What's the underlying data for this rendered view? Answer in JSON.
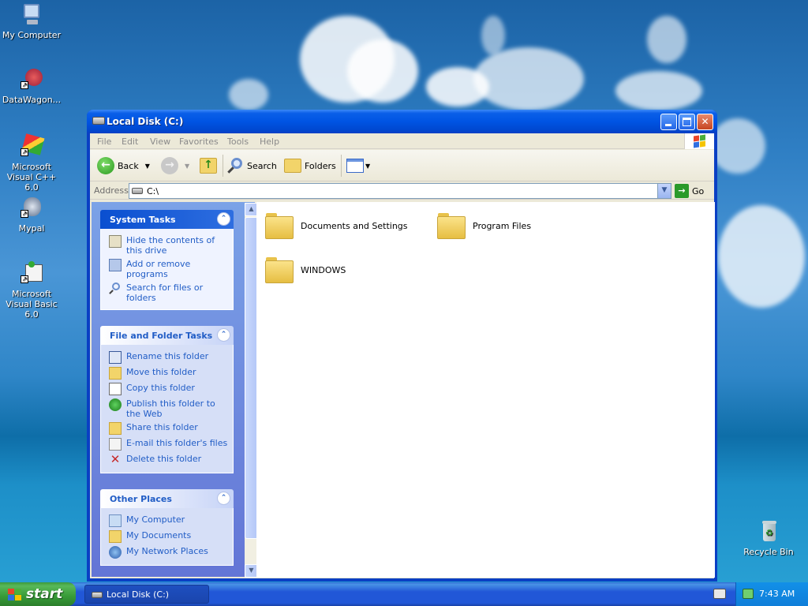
{
  "desktop": {
    "icons": [
      {
        "label": "My Computer"
      },
      {
        "label": "DataWagon..."
      },
      {
        "label": "Microsoft Visual C++ 6.0"
      },
      {
        "label": "Mypal"
      },
      {
        "label": "Microsoft Visual Basic 6.0"
      },
      {
        "label": "Recycle Bin"
      }
    ]
  },
  "window": {
    "title": "Local Disk (C:)",
    "menu": [
      "File",
      "Edit",
      "View",
      "Favorites",
      "Tools",
      "Help"
    ],
    "toolbar": {
      "back": "Back",
      "search": "Search",
      "folders": "Folders"
    },
    "address": {
      "label": "Address",
      "value": "C:\\",
      "go": "Go"
    },
    "taskpane": {
      "system_tasks": {
        "title": "System Tasks",
        "items": [
          "Hide the contents of this drive",
          "Add or remove programs",
          "Search for files or folders"
        ]
      },
      "file_folder_tasks": {
        "title": "File and Folder Tasks",
        "items": [
          "Rename this folder",
          "Move this folder",
          "Copy this folder",
          "Publish this folder to the Web",
          "Share this folder",
          "E-mail this folder's files",
          "Delete this folder"
        ]
      },
      "other_places": {
        "title": "Other Places",
        "items": [
          "My Computer",
          "My Documents",
          "My Network Places"
        ]
      }
    },
    "folders": [
      "Documents and Settings",
      "Program Files",
      "WINDOWS"
    ]
  },
  "taskbar": {
    "start": "start",
    "task": "Local Disk (C:)",
    "clock": "7:43 AM"
  },
  "colors": {
    "title_blue": "#0054e3",
    "link_blue": "#215dc6",
    "start_green": "#379a37",
    "folder_yellow": "#f7d75a"
  }
}
